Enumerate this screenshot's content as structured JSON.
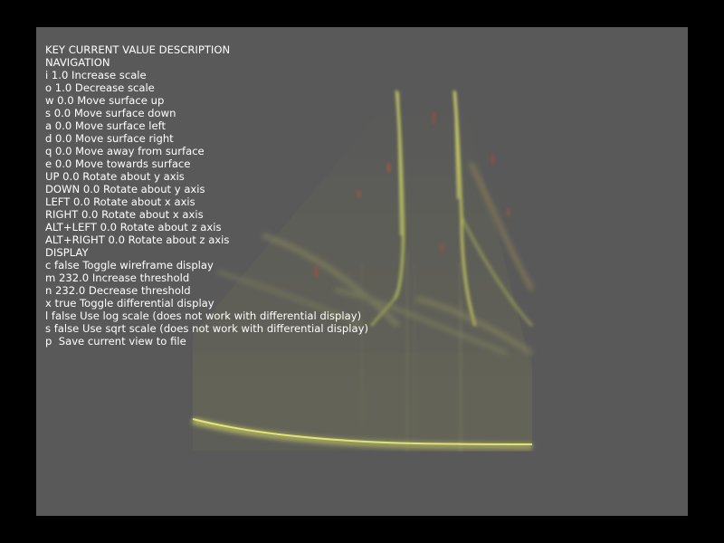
{
  "window": {
    "background": "#000000",
    "viewport_background": "#595959",
    "text_color": "#ffffff"
  },
  "overlay": {
    "header": "KEY CURRENT VALUE DESCRIPTION",
    "navigation_heading": "NAVIGATION",
    "navigation": [
      {
        "key": "i",
        "value": "1.0",
        "description": "Increase scale"
      },
      {
        "key": "o",
        "value": "1.0",
        "description": "Decrease scale"
      },
      {
        "key": "w",
        "value": "0.0",
        "description": "Move surface up"
      },
      {
        "key": "s",
        "value": "0.0",
        "description": "Move surface down"
      },
      {
        "key": "a",
        "value": "0.0",
        "description": "Move surface left"
      },
      {
        "key": "d",
        "value": "0.0",
        "description": "Move surface right"
      },
      {
        "key": "q",
        "value": "0.0",
        "description": "Move away from surface"
      },
      {
        "key": "e",
        "value": "0.0",
        "description": "Move towards surface"
      },
      {
        "key": "UP",
        "value": "0.0",
        "description": "Rotate about y axis"
      },
      {
        "key": "DOWN",
        "value": "0.0",
        "description": "Rotate about y axis"
      },
      {
        "key": "LEFT",
        "value": "0.0",
        "description": "Rotate about x axis"
      },
      {
        "key": "RIGHT",
        "value": "0.0",
        "description": "Rotate about x axis"
      },
      {
        "key": "ALT+LEFT",
        "value": "0.0",
        "description": "Rotate about z axis"
      },
      {
        "key": "ALT+RIGHT",
        "value": "0.0",
        "description": "Rotate about z axis"
      }
    ],
    "display_heading": "DISPLAY",
    "display": [
      {
        "key": "c",
        "value": "false",
        "description": "Toggle wireframe display"
      },
      {
        "key": "m",
        "value": "232.0",
        "description": "Increase threshold"
      },
      {
        "key": "n",
        "value": "232.0",
        "description": "Decrease threshold"
      },
      {
        "key": "x",
        "value": "true",
        "description": "Toggle differential display"
      },
      {
        "key": "l",
        "value": "false",
        "description": "Use log scale (does not work with differential display)"
      },
      {
        "key": "s",
        "value": "false",
        "description": "Use sqrt scale (does not work with differential display)"
      },
      {
        "key": "p",
        "value": "",
        "description": "Save current view to file"
      }
    ]
  }
}
